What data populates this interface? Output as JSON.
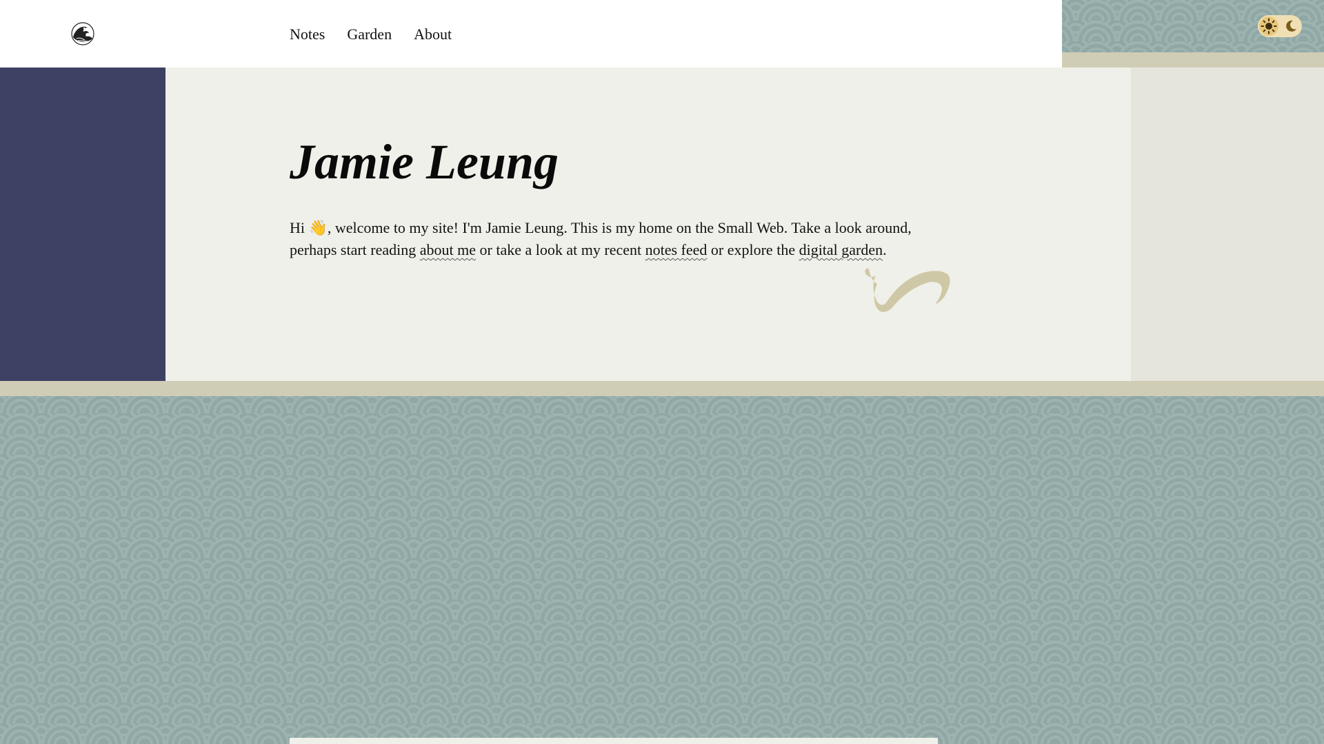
{
  "site": {
    "logo_icon": "great-wave-icon"
  },
  "nav": {
    "items": [
      {
        "label": "Notes"
      },
      {
        "label": "Garden"
      },
      {
        "label": "About"
      }
    ]
  },
  "theme_toggle": {
    "light_icon": "sun-icon",
    "dark_icon": "moon-icon",
    "active": "light"
  },
  "hero": {
    "title": "Jamie Leung",
    "intro_1": "Hi ",
    "emoji": "👋",
    "intro_2": ", welcome to my site! I'm Jamie Leung. This is my home on the Small Web. Take a look around, perhaps start reading ",
    "link_about": "about me",
    "intro_3": " or take a look at my recent ",
    "link_notes": "notes feed",
    "intro_4": " or explore the ",
    "link_garden": "digital garden",
    "intro_5": "."
  },
  "colors": {
    "header_bg": "#ffffff",
    "sidebar_navy": "#3e4164",
    "hero_bg": "#f0f0ea",
    "band_tan": "#d0cdb6",
    "wave_teal": "#8fa7a5",
    "brush_tan": "#cfc8a6"
  }
}
